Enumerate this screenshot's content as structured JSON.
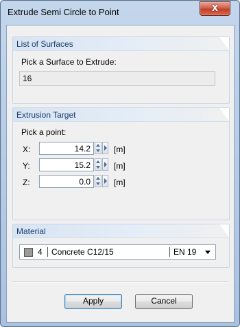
{
  "window": {
    "title": "Extrude Semi Circle to Point",
    "close_icon": "close-x-icon",
    "close_glyph": "X"
  },
  "surfaces": {
    "header": "List of Surfaces",
    "prompt": "Pick a Surface to Extrude:",
    "value": "16"
  },
  "target": {
    "header": "Extrusion Target",
    "prompt": "Pick a point:",
    "coords": [
      {
        "label": "X:",
        "value": "14.2",
        "unit": "[m]"
      },
      {
        "label": "Y:",
        "value": "15.2",
        "unit": "[m]"
      },
      {
        "label": "Z:",
        "value": "0.0",
        "unit": "[m]"
      }
    ]
  },
  "material": {
    "header": "Material",
    "number": "4",
    "name": "Concrete C12/15",
    "code": "EN 19",
    "swatch_color": "#9a9a9a"
  },
  "buttons": {
    "apply": "Apply",
    "cancel": "Cancel"
  }
}
